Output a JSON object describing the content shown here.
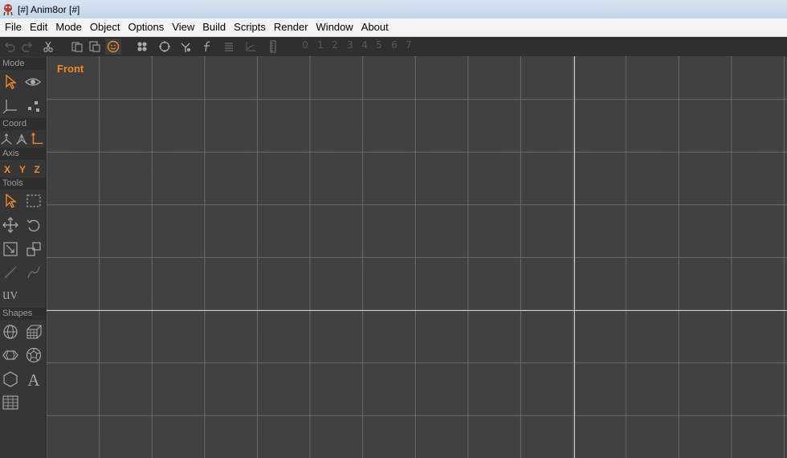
{
  "window": {
    "title": "[#] Anim8or [#]",
    "icon": "anim8or-app-icon"
  },
  "menubar": {
    "items": [
      {
        "label": "File"
      },
      {
        "label": "Edit"
      },
      {
        "label": "Mode"
      },
      {
        "label": "Object"
      },
      {
        "label": "Options"
      },
      {
        "label": "View"
      },
      {
        "label": "Build"
      },
      {
        "label": "Scripts"
      },
      {
        "label": "Render"
      },
      {
        "label": "Window"
      },
      {
        "label": "About"
      }
    ]
  },
  "toolbar": {
    "icons": [
      "undo-icon",
      "redo-icon",
      "cut-icon",
      "copy-icon",
      "paste-icon",
      "smiley-icon",
      "point-group-icon",
      "rotate-circle-icon",
      "move-down-icon",
      "function-icon",
      "list-icon",
      "graph-icon",
      "ruler-icon"
    ],
    "numbers": [
      "0",
      "1",
      "2",
      "3",
      "4",
      "5",
      "6",
      "7"
    ],
    "selected": "smiley-icon"
  },
  "leftpanel": {
    "sections": {
      "mode": "Mode",
      "coord": "Coord",
      "axis": "Axis",
      "tools": "Tools",
      "shapes": "Shapes"
    },
    "axis_buttons": [
      "X",
      "Y",
      "Z"
    ],
    "uv_label": "uv"
  },
  "viewport": {
    "label": "Front"
  },
  "colors": {
    "accent": "#f08a24",
    "panel": "#363636",
    "viewport": "#414141",
    "grid": "#6e6e6e",
    "axis": "#cfcfcf"
  }
}
